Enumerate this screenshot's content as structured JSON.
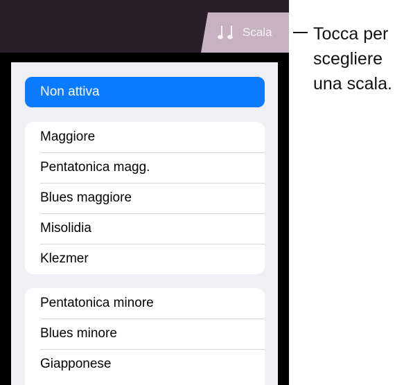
{
  "header": {
    "scale_button_label": "Scala",
    "scale_icon": "music-notes-icon"
  },
  "popover": {
    "none_option": "Non attiva",
    "group1": [
      "Maggiore",
      "Pentatonica magg.",
      "Blues maggiore",
      "Misolidia",
      "Klezmer"
    ],
    "group2": [
      "Pentatonica minore",
      "Blues minore",
      "Giapponese"
    ]
  },
  "callout": {
    "text": "Tocca per\nscegliere\nuna scala."
  },
  "colors": {
    "accent": "#0a7aff",
    "topbar": "#2b1e2b",
    "tab": "#c6b2c2",
    "popover_bg": "#efeff4"
  }
}
